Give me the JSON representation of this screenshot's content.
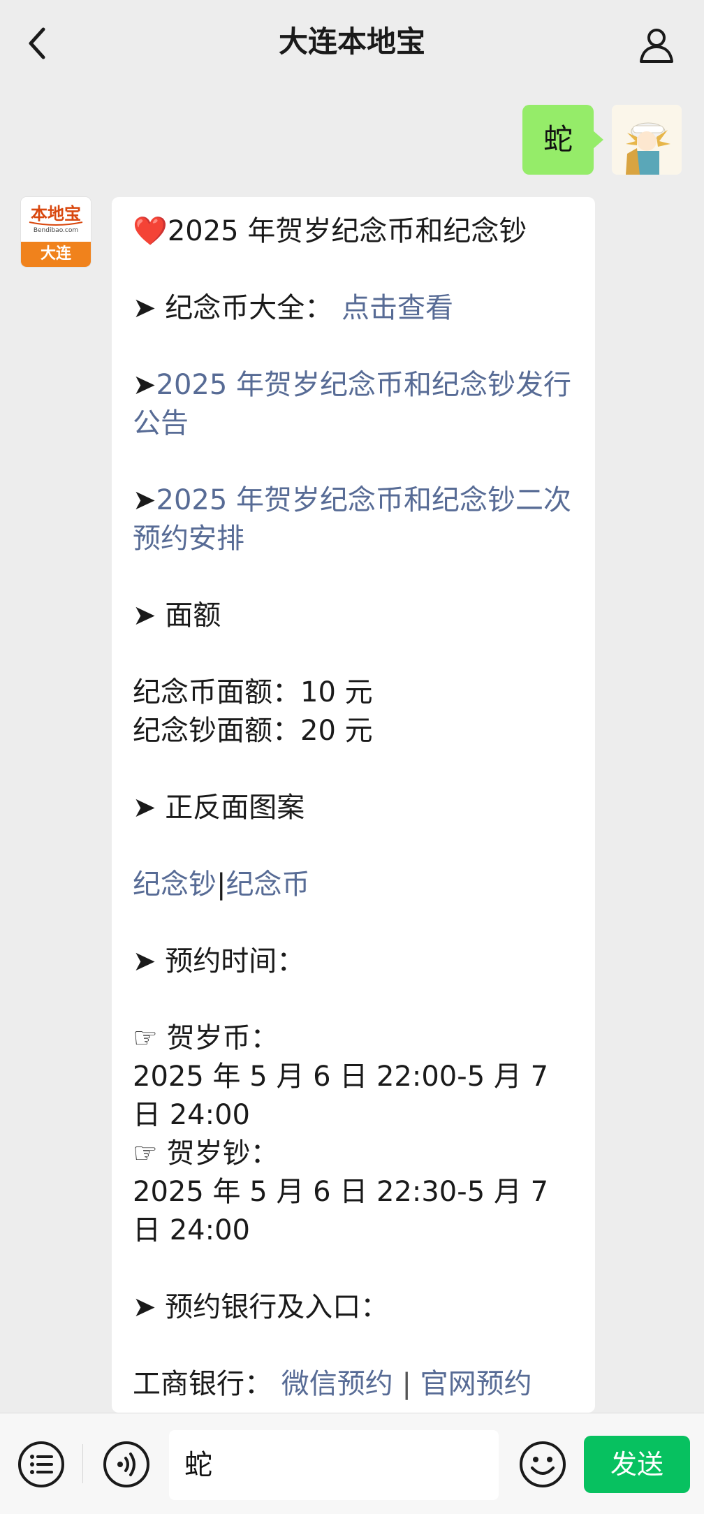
{
  "header": {
    "title": "大连本地宝",
    "back_icon": "chevron-left-icon",
    "profile_icon": "person-icon"
  },
  "user_message": {
    "text": "蛇",
    "bubble_color": "#95ec69"
  },
  "bot_avatar": {
    "logo_text": "本地宝",
    "logo_sub": "Bendibao.com",
    "city": "大连",
    "brand_color": "#f0821c"
  },
  "bot_message": {
    "title_emoji": "❤️",
    "title": "2025 年贺岁纪念币和纪念钞",
    "arrow": "➤",
    "hand": "☞",
    "coin_all_label": "纪念币大全：",
    "coin_all_link": "点击查看",
    "notice_link": "2025 年贺岁纪念币和纪念钞发行公告",
    "second_reservation_link": "2025 年贺岁纪念币和纪念钞二次预约安排",
    "denomination_heading": "面额",
    "coin_denomination": "纪念币面额：10 元",
    "note_denomination": "纪念钞面额：20 元",
    "design_heading": "正反面图案",
    "note_link": "纪念钞",
    "separator": "|",
    "coin_link": "纪念币",
    "reserve_time_heading": "预约时间：",
    "coin_label": "贺岁币：",
    "coin_time": "2025 年 5 月 6 日 22:00-5 月 7 日 24:00",
    "note_label": "贺岁钞：",
    "note_time": "2025 年 5 月 6 日 22:30-5 月 7 日 24:00",
    "bank_heading": "预约银行及入口：",
    "icbc_label": "工商银行：",
    "wechat_link": "微信预约",
    "bank_separator": "|",
    "website_link": "官网预约",
    "link_color": "#576b95"
  },
  "input_bar": {
    "menu_icon": "list-menu-icon",
    "voice_icon": "voice-icon",
    "input_value": "蛇",
    "emoji_icon": "emoji-icon",
    "send_label": "发送",
    "send_color": "#07c160"
  }
}
